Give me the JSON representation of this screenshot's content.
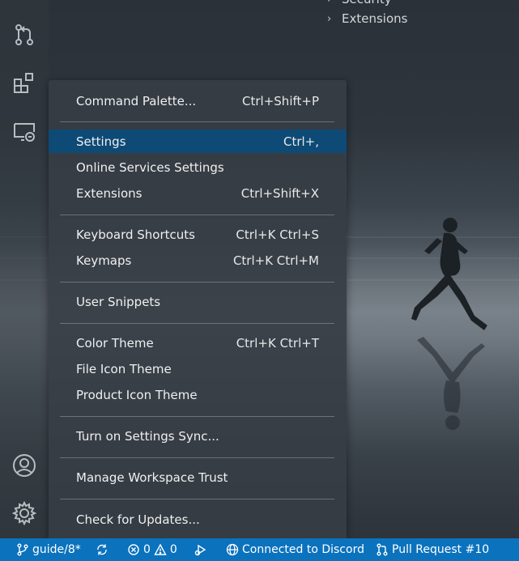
{
  "explorer": {
    "items": [
      {
        "label": "Security",
        "icon": "chevron-right-icon"
      },
      {
        "label": "Extensions",
        "icon": "chevron-right-icon"
      }
    ]
  },
  "activity_bar": {
    "top_icons": [
      "source-control-icon",
      "extensions-icon",
      "remote-explorer-icon"
    ],
    "bottom_icons": [
      "accounts-icon",
      "manage-gear-icon"
    ]
  },
  "menu": {
    "items": [
      {
        "label": "Command Palette...",
        "shortcut": "Ctrl+Shift+P"
      },
      {
        "label": "Settings",
        "shortcut": "Ctrl+,",
        "selected": true
      },
      {
        "label": "Online Services Settings",
        "shortcut": ""
      },
      {
        "label": "Extensions",
        "shortcut": "Ctrl+Shift+X"
      },
      {
        "label": "Keyboard Shortcuts",
        "shortcut": "Ctrl+K Ctrl+S"
      },
      {
        "label": "Keymaps",
        "shortcut": "Ctrl+K Ctrl+M"
      },
      {
        "label": "User Snippets",
        "shortcut": ""
      },
      {
        "label": "Color Theme",
        "shortcut": "Ctrl+K Ctrl+T"
      },
      {
        "label": "File Icon Theme",
        "shortcut": ""
      },
      {
        "label": "Product Icon Theme",
        "shortcut": ""
      },
      {
        "label": "Turn on Settings Sync...",
        "shortcut": ""
      },
      {
        "label": "Manage Workspace Trust",
        "shortcut": ""
      },
      {
        "label": "Check for Updates...",
        "shortcut": ""
      }
    ]
  },
  "status_bar": {
    "branch": "guide/8*",
    "errors": "0",
    "warnings": "0",
    "discord": "Connected to Discord",
    "pull_request": "Pull Request #10",
    "background_color": "#0b72bd"
  },
  "colors": {
    "menu_selected": "#0e4a76",
    "status_bar": "#0b72bd"
  }
}
